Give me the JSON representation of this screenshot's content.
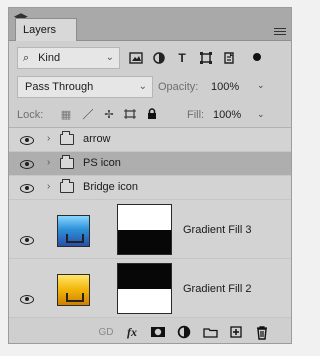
{
  "panel": {
    "tab_label": "Layers"
  },
  "filter": {
    "selected": "Kind",
    "icons": [
      "pixel-filter-icon",
      "adjustment-filter-icon",
      "type-filter-icon",
      "shape-filter-icon",
      "smartobject-filter-icon",
      "filter-toggle-icon"
    ]
  },
  "blend": {
    "mode": "Pass Through",
    "opacity_label": "Opacity:",
    "opacity_value": "100%"
  },
  "lock": {
    "label": "Lock:",
    "fill_label": "Fill:",
    "fill_value": "100%",
    "icons": [
      "lock-transparent-icon",
      "lock-image-icon",
      "lock-position-icon",
      "lock-artboard-icon",
      "lock-all-icon"
    ]
  },
  "layers": {
    "groups": [
      {
        "name": "arrow",
        "selected": false,
        "visible": true
      },
      {
        "name": "PS icon",
        "selected": true,
        "visible": true
      },
      {
        "name": "Bridge icon",
        "selected": false,
        "visible": true
      }
    ],
    "fill_layers": [
      {
        "name": "Gradient Fill 3",
        "visible": true,
        "thumb_color": "#2c91d8",
        "mask": "white-top-black-bottom"
      },
      {
        "name": "Gradient Fill 2",
        "visible": true,
        "thumb_color": "#f2b60a",
        "mask": "black-top-white-bottom"
      }
    ]
  },
  "footer": {
    "fx_label": "fx",
    "icons": [
      "link-layers-icon",
      "fx-icon",
      "add-mask-icon",
      "adjustment-icon",
      "new-group-icon",
      "new-layer-icon",
      "delete-icon"
    ]
  },
  "colors": {
    "panel_background": "#cfcfcf",
    "tab_bar": "#a9a9a9",
    "selected_row": "#aeaeae",
    "blue_thumb": "#2c91d8",
    "gold_thumb": "#f2b60a"
  }
}
